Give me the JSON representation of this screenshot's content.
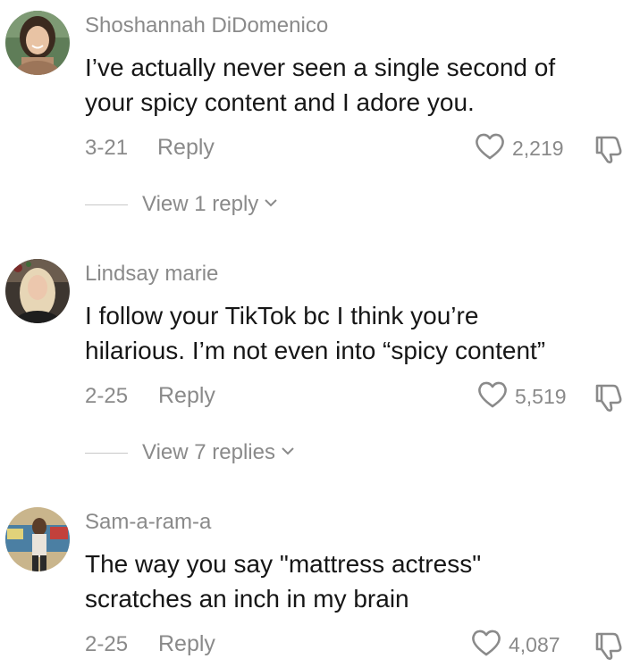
{
  "comments": [
    {
      "username": "Shoshannah DiDomenico",
      "text_line1": "I’ve actually never seen a single second of",
      "text_line2": "your spicy content and I adore you.",
      "date": "3-21",
      "reply_label": "Reply",
      "likes": "2,219",
      "view_replies": "View 1 reply"
    },
    {
      "username": "Lindsay marie",
      "text_line1": "I follow your TikTok bc I think you’re",
      "text_line2": "hilarious. I’m not even into “spicy content”",
      "date": "2-25",
      "reply_label": "Reply",
      "likes": "5,519",
      "view_replies": "View 7 replies"
    },
    {
      "username": "Sam-a-ram-a",
      "text_line1": "The way you say \"mattress actress\"",
      "text_line2": "scratches an inch in my brain",
      "date": "2-25",
      "reply_label": "Reply",
      "likes": "4,087"
    }
  ],
  "icons": {
    "like": "heart-outline-icon",
    "dislike": "thumbs-down-icon",
    "expand": "chevron-down-icon"
  },
  "colors": {
    "text": "#161616",
    "secondary": "#8a8a8a",
    "divider": "#c8c8c8"
  }
}
